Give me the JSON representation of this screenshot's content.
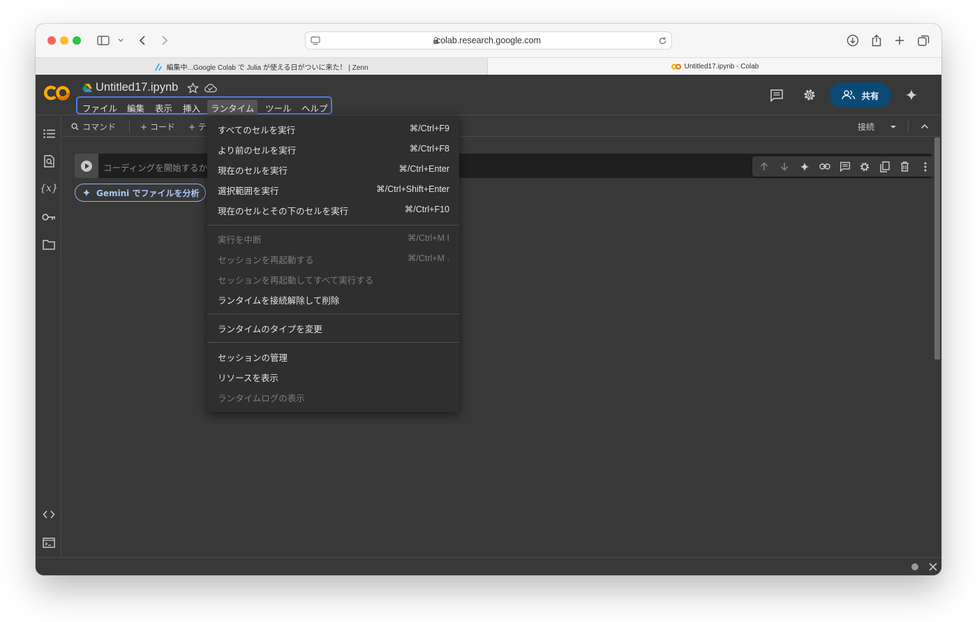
{
  "browser": {
    "url": "colab.research.google.com",
    "tabs": [
      {
        "label": "編集中...Google Colab で Julia が使える日がついに来た！ | Zenn"
      },
      {
        "label": "Untitled17.ipynb - Colab"
      }
    ]
  },
  "header": {
    "notebook_title": "Untitled17.ipynb",
    "share_label": "共有",
    "menus": [
      {
        "label": "ファイル"
      },
      {
        "label": "編集"
      },
      {
        "label": "表示"
      },
      {
        "label": "挿入"
      },
      {
        "label": "ランタイム"
      },
      {
        "label": "ツール"
      },
      {
        "label": "ヘルプ"
      }
    ]
  },
  "toolbar": {
    "command_label": "コマンド",
    "add_code_label": "+ コード",
    "add_text_label": "+ テ",
    "connect_label": "接続"
  },
  "cell": {
    "placeholder": "コーディングを開始するか"
  },
  "gemini": {
    "label": "Gemini でファイルを分析"
  },
  "runtime_menu": {
    "groups": [
      [
        {
          "label": "すべてのセルを実行",
          "shortcut": "⌘/Ctrl+F9",
          "enabled": true
        },
        {
          "label": "より前のセルを実行",
          "shortcut": "⌘/Ctrl+F8",
          "enabled": true
        },
        {
          "label": "現在のセルを実行",
          "shortcut": "⌘/Ctrl+Enter",
          "enabled": true
        },
        {
          "label": "選択範囲を実行",
          "shortcut": "⌘/Ctrl+Shift+Enter",
          "enabled": true
        },
        {
          "label": "現在のセルとその下のセルを実行",
          "shortcut": "⌘/Ctrl+F10",
          "enabled": true
        }
      ],
      [
        {
          "label": "実行を中断",
          "shortcut": "⌘/Ctrl+M I",
          "enabled": false
        },
        {
          "label": "セッションを再起動する",
          "shortcut": "⌘/Ctrl+M .",
          "enabled": false
        },
        {
          "label": "セッションを再起動してすべて実行する",
          "shortcut": "",
          "enabled": false
        },
        {
          "label": "ランタイムを接続解除して削除",
          "shortcut": "",
          "enabled": true
        }
      ],
      [
        {
          "label": "ランタイムのタイプを変更",
          "shortcut": "",
          "enabled": true
        }
      ],
      [
        {
          "label": "セッションの管理",
          "shortcut": "",
          "enabled": true
        },
        {
          "label": "リソースを表示",
          "shortcut": "",
          "enabled": true
        },
        {
          "label": "ランタイムログの表示",
          "shortcut": "",
          "enabled": false
        }
      ]
    ]
  },
  "colors": {
    "accent_blue": "#4f7bd9",
    "share_bg": "#0b4a74",
    "logo_orange": "#f9ab00",
    "logo_dark_orange": "#e8710a",
    "disabled_text": "#7c7c7c"
  }
}
